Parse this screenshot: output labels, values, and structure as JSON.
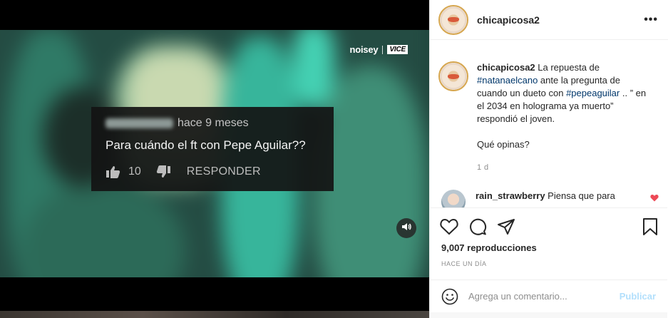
{
  "video": {
    "logo": "noisey",
    "logo_partner": "VICE",
    "comment_card": {
      "time": "hace 9 meses",
      "text": "Para cuándo el ft con Pepe Aguilar??",
      "likes": "10",
      "reply_label": "RESPONDER"
    },
    "sound_icon": "speaker-icon"
  },
  "post": {
    "username": "chicapicosa2",
    "more_label": "•••",
    "caption": {
      "username": "chicapicosa2",
      "part1": " La repuesta de ",
      "tag1": "#natanaelcano",
      "part2": " ante la pregunta de cuando un dueto con ",
      "tag2": "#pepeaguilar",
      "part3": " .. ” en el 2034 en holograma ya muerto” respondió el joven.",
      "question": "Qué opinas?",
      "ago": "1 d"
    },
    "reply": {
      "username": "rain_strawberry",
      "text": " Piensa que para"
    },
    "views": "9,007 reproducciones",
    "date": "HACE UN DÍA",
    "comment_placeholder": "Agrega un comentario...",
    "publish_label": "Publicar"
  },
  "colors": {
    "link": "#00376b",
    "publish_disabled": "#b2dffc",
    "heart": "#ed4956"
  }
}
